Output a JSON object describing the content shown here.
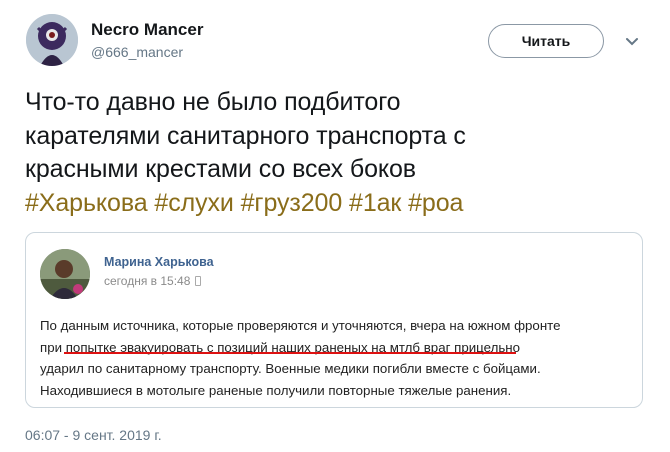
{
  "user": {
    "name": "Necro Mancer",
    "handle": "@666_mancer",
    "follow_label": "Читать"
  },
  "tweet": {
    "lines": [
      "Что-то давно не было подбитого",
      "карателями санитарного транспорта с",
      "красными крестами со всех боков"
    ],
    "hashtags": [
      "#Харькова",
      "#слухи",
      "#груз200",
      "#1ак",
      "#роа"
    ],
    "timestamp": "06:07 - 9 сент. 2019 г."
  },
  "embedded_post": {
    "author": "Марина Харькова",
    "time": "сегодня в 15:48",
    "body_lines": [
      "По данным источника, которые проверяются и уточняются, вчера на южном фронте",
      "при попытке эвакуировать с позиций наших раненых на мтлб враг прицельно",
      "ударил по санитарному транспорту. Военные медики погибли вместе с бойцами.",
      "Находившиеся в мотолыге раненые получили повторные тяжелые ранения."
    ]
  },
  "colors": {
    "hashtag": "#8a6d1a",
    "author_link": "#3f6390",
    "underline": "#dd1111"
  },
  "icons": {
    "menu": "chevron-down-icon",
    "device": "phone-icon"
  }
}
